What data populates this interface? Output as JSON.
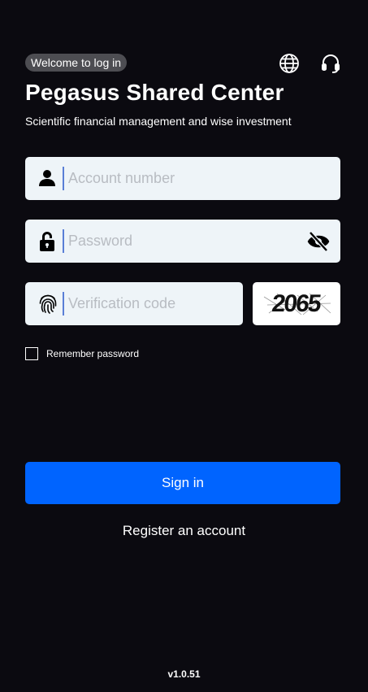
{
  "header": {
    "welcome_badge": "Welcome to log in",
    "language_icon": "globe-icon",
    "support_icon": "headset-icon"
  },
  "title": "Pegasus Shared Center",
  "subtitle": "Scientific financial management and wise investment",
  "form": {
    "account": {
      "placeholder": "Account number",
      "value": "",
      "icon": "user-icon"
    },
    "password": {
      "placeholder": "Password",
      "value": "",
      "icon": "lock-icon",
      "toggle_icon": "eye-off-icon"
    },
    "verification": {
      "placeholder": "Verification code",
      "value": "",
      "icon": "fingerprint-icon",
      "captcha_text": "2065"
    },
    "remember_label": "Remember password",
    "remember_checked": false
  },
  "actions": {
    "sign_in": "Sign in",
    "register": "Register an account"
  },
  "footer": {
    "version": "v1.0.51"
  },
  "colors": {
    "background": "#0b0a10",
    "primary": "#0064ff",
    "field_bg": "#eef4f8",
    "badge_bg": "#4d4d52",
    "separator": "#5a7fd6"
  }
}
